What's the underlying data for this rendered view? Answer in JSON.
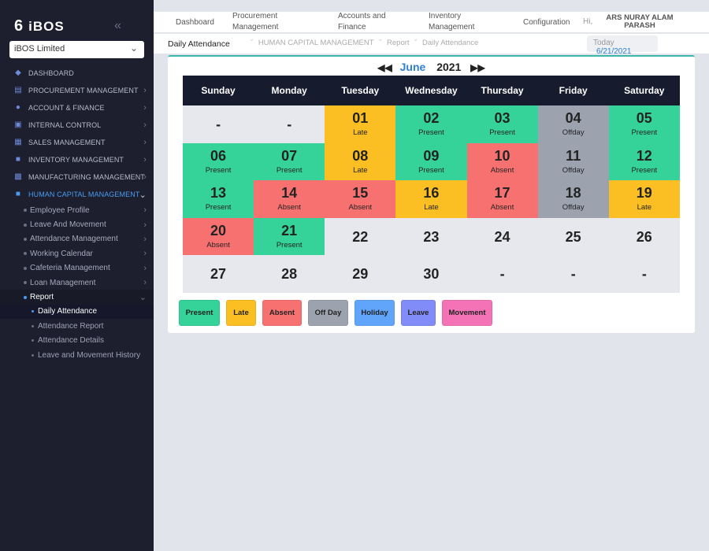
{
  "brand": {
    "name": "iBOS",
    "mark": "6"
  },
  "company": {
    "value": "iBOS Limited"
  },
  "sidebar": {
    "items": [
      {
        "label": "DASHBOARD",
        "icon": "dashboard-icon"
      },
      {
        "label": "PROCUREMENT MANAGEMENT",
        "icon": "basket-icon"
      },
      {
        "label": "ACCOUNT & FINANCE",
        "icon": "finance-icon"
      },
      {
        "label": "INTERNAL CONTROL",
        "icon": "control-icon"
      },
      {
        "label": "SALES MANAGEMENT",
        "icon": "chart-icon"
      },
      {
        "label": "INVENTORY MANAGEMENT",
        "icon": "inventory-icon"
      },
      {
        "label": "MANUFACTURING MANAGEMENT",
        "icon": "factory-icon"
      },
      {
        "label": "HUMAN CAPITAL MANAGEMENT",
        "icon": "person-icon"
      }
    ],
    "hcm_sub": [
      "Employee Profile",
      "Leave And Movement",
      "Attendance Management",
      "Working Calendar",
      "Cafeteria Management",
      "Loan Management",
      "Report"
    ],
    "report_sub": [
      "Daily Attendance",
      "Attendance Report",
      "Attendance Details",
      "Leave and Movement History"
    ]
  },
  "topnav": {
    "dashboard": "Dashboard",
    "procurement_1": "Procurement",
    "procurement_2": "Management",
    "accounts_1": "Accounts and",
    "accounts_2": "Finance",
    "inventory_1": "Inventory",
    "inventory_2": "Management",
    "configuration": "Configuration",
    "hi": "Hi,",
    "user_1": "ARS NURAY ALAM",
    "user_2": "PARASH"
  },
  "page": {
    "title": "Daily Attendance",
    "breadcrumb": [
      "HUMAN CAPITAL MANAGEMENT",
      "Report",
      "Daily Attendance"
    ],
    "today_label": "Today",
    "today_value": "6/21/2021"
  },
  "calendar": {
    "month": "June",
    "year": "2021",
    "weekdays": [
      "Sunday",
      "Monday",
      "Tuesday",
      "Wednesday",
      "Thursday",
      "Friday",
      "Saturday"
    ],
    "cells": [
      {
        "day": "-",
        "status": "",
        "kind": "none"
      },
      {
        "day": "-",
        "status": "",
        "kind": "none"
      },
      {
        "day": "01",
        "status": "Late",
        "kind": "late"
      },
      {
        "day": "02",
        "status": "Present",
        "kind": "present"
      },
      {
        "day": "03",
        "status": "Present",
        "kind": "present"
      },
      {
        "day": "04",
        "status": "Offday",
        "kind": "offday"
      },
      {
        "day": "05",
        "status": "Present",
        "kind": "present"
      },
      {
        "day": "06",
        "status": "Present",
        "kind": "present"
      },
      {
        "day": "07",
        "status": "Present",
        "kind": "present"
      },
      {
        "day": "08",
        "status": "Late",
        "kind": "late"
      },
      {
        "day": "09",
        "status": "Present",
        "kind": "present"
      },
      {
        "day": "10",
        "status": "Absent",
        "kind": "absent"
      },
      {
        "day": "11",
        "status": "Offday",
        "kind": "offday"
      },
      {
        "day": "12",
        "status": "Present",
        "kind": "present"
      },
      {
        "day": "13",
        "status": "Present",
        "kind": "present"
      },
      {
        "day": "14",
        "status": "Absent",
        "kind": "absent"
      },
      {
        "day": "15",
        "status": "Absent",
        "kind": "absent"
      },
      {
        "day": "16",
        "status": "Late",
        "kind": "late"
      },
      {
        "day": "17",
        "status": "Absent",
        "kind": "absent"
      },
      {
        "day": "18",
        "status": "Offday",
        "kind": "offday"
      },
      {
        "day": "19",
        "status": "Late",
        "kind": "late"
      },
      {
        "day": "20",
        "status": "Absent",
        "kind": "absent"
      },
      {
        "day": "21",
        "status": "Present",
        "kind": "present"
      },
      {
        "day": "22",
        "status": "",
        "kind": "none"
      },
      {
        "day": "23",
        "status": "",
        "kind": "none"
      },
      {
        "day": "24",
        "status": "",
        "kind": "none"
      },
      {
        "day": "25",
        "status": "",
        "kind": "none"
      },
      {
        "day": "26",
        "status": "",
        "kind": "none"
      },
      {
        "day": "27",
        "status": "",
        "kind": "none"
      },
      {
        "day": "28",
        "status": "",
        "kind": "none"
      },
      {
        "day": "29",
        "status": "",
        "kind": "none"
      },
      {
        "day": "30",
        "status": "",
        "kind": "none"
      },
      {
        "day": "-",
        "status": "",
        "kind": "none"
      },
      {
        "day": "-",
        "status": "",
        "kind": "none"
      },
      {
        "day": "-",
        "status": "",
        "kind": "none"
      }
    ]
  },
  "legend": [
    {
      "label": "Present",
      "color": "#35d399"
    },
    {
      "label": "Late",
      "color": "#fbbf24"
    },
    {
      "label": "Absent",
      "color": "#f87171"
    },
    {
      "label": "Off Day",
      "color": "#9ca3af"
    },
    {
      "label": "Holiday",
      "color": "#60a5fa"
    },
    {
      "label": "Leave",
      "color": "#818cf8"
    },
    {
      "label": "Movement",
      "color": "#f472b6"
    }
  ]
}
